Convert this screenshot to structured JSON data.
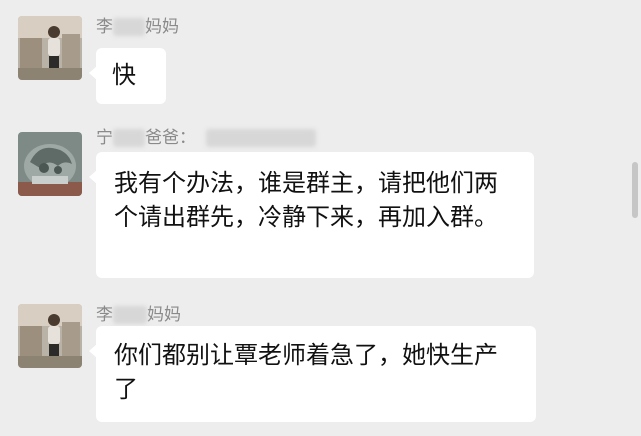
{
  "messages": [
    {
      "sender_prefix": "李",
      "sender_suffix": "妈妈",
      "text": "快",
      "avatar_icon": "photo-person-avatar"
    },
    {
      "sender_prefix": "宁",
      "sender_suffix": "爸爸：",
      "text": "我有个办法，谁是群主，请把他们两个请出群先，冷静下来，再加入群。",
      "avatar_icon": "stone-statue-avatar"
    },
    {
      "sender_prefix": "李",
      "sender_suffix": "妈妈",
      "text": "你们都别让覃老师着急了，她快生产了",
      "avatar_icon": "photo-person-avatar"
    }
  ],
  "colors": {
    "background": "#ededed",
    "bubble": "#ffffff",
    "sender_text": "#8a8a8a"
  }
}
